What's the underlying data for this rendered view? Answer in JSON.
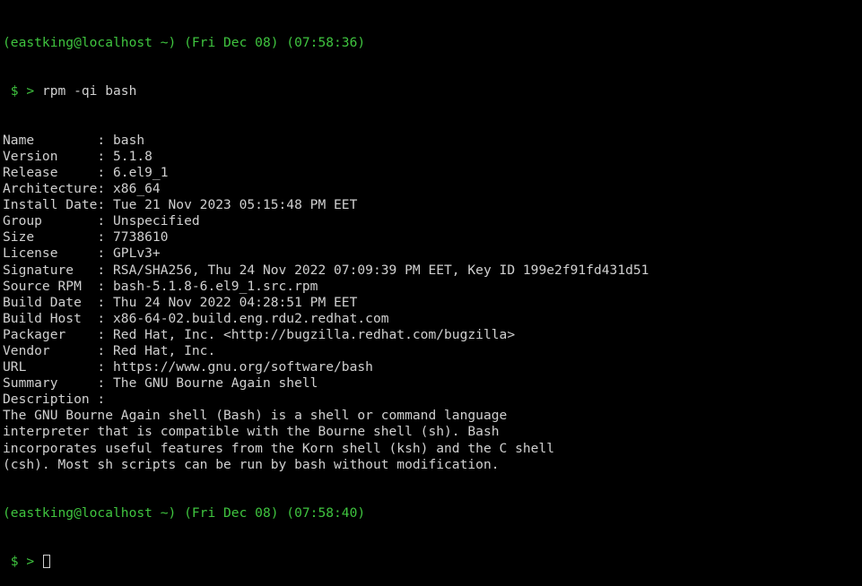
{
  "colors": {
    "background": "#000000",
    "prompt_green": "#3fc43f",
    "text": "#d0d0d0"
  },
  "session1": {
    "header": "(eastking@localhost ~) (Fri Dec 08) (07:58:36)",
    "prompt": " $ > ",
    "command": "rpm -qi bash"
  },
  "output": [
    "Name        : bash",
    "Version     : 5.1.8",
    "Release     : 6.el9_1",
    "Architecture: x86_64",
    "Install Date: Tue 21 Nov 2023 05:15:48 PM EET",
    "Group       : Unspecified",
    "Size        : 7738610",
    "License     : GPLv3+",
    "Signature   : RSA/SHA256, Thu 24 Nov 2022 07:09:39 PM EET, Key ID 199e2f91fd431d51",
    "Source RPM  : bash-5.1.8-6.el9_1.src.rpm",
    "Build Date  : Thu 24 Nov 2022 04:28:51 PM EET",
    "Build Host  : x86-64-02.build.eng.rdu2.redhat.com",
    "Packager    : Red Hat, Inc. <http://bugzilla.redhat.com/bugzilla>",
    "Vendor      : Red Hat, Inc.",
    "URL         : https://www.gnu.org/software/bash",
    "Summary     : The GNU Bourne Again shell",
    "Description :",
    "The GNU Bourne Again shell (Bash) is a shell or command language",
    "interpreter that is compatible with the Bourne shell (sh). Bash",
    "incorporates useful features from the Korn shell (ksh) and the C shell",
    "(csh). Most sh scripts can be run by bash without modification."
  ],
  "session2": {
    "header": "(eastking@localhost ~) (Fri Dec 08) (07:58:40)",
    "prompt": " $ > "
  }
}
